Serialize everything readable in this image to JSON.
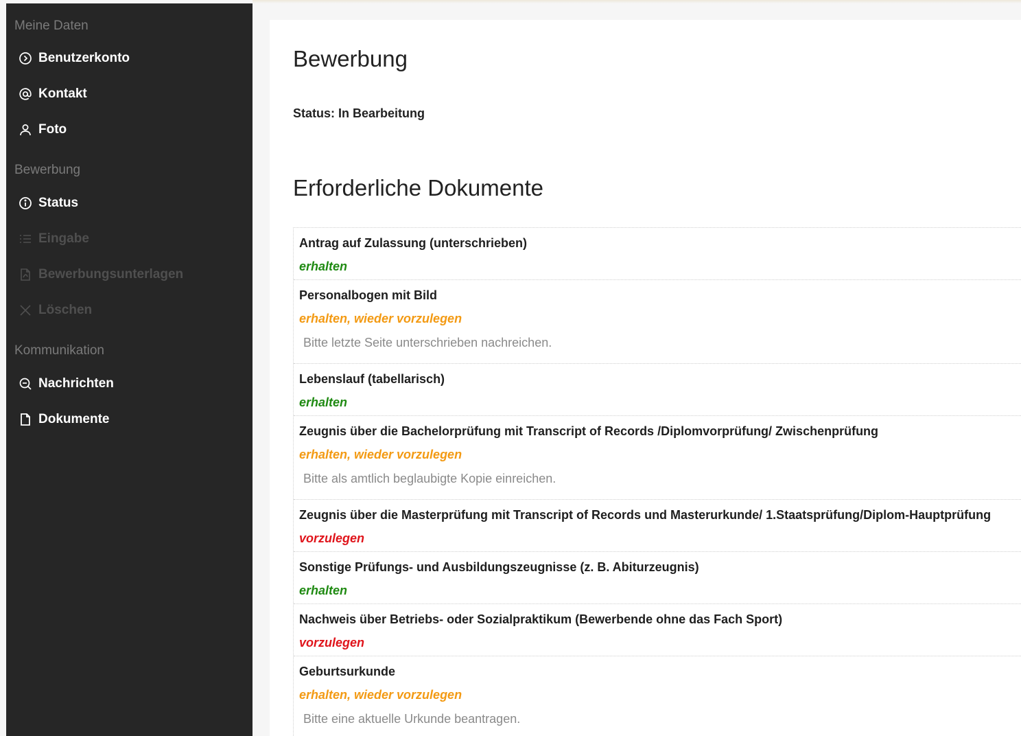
{
  "sidebar": {
    "sections": [
      {
        "label": "Meine Daten",
        "items": [
          {
            "label": "Benutzerkonto",
            "icon": "chevron-circle-icon",
            "disabled": false
          },
          {
            "label": "Kontakt",
            "icon": "at-icon",
            "disabled": false
          },
          {
            "label": "Foto",
            "icon": "user-icon",
            "disabled": false
          }
        ]
      },
      {
        "label": "Bewerbung",
        "items": [
          {
            "label": "Status",
            "icon": "info-circle-icon",
            "disabled": false,
            "active": true
          },
          {
            "label": "Eingabe",
            "icon": "list-icon",
            "disabled": true
          },
          {
            "label": "Bewerbungsunterlagen",
            "icon": "pdf-file-icon",
            "disabled": true
          },
          {
            "label": "Löschen",
            "icon": "close-icon",
            "disabled": true
          }
        ]
      },
      {
        "label": "Kommunikation",
        "items": [
          {
            "label": "Nachrichten",
            "icon": "chat-icon",
            "disabled": false
          },
          {
            "label": "Dokumente",
            "icon": "document-icon",
            "disabled": false
          }
        ]
      }
    ]
  },
  "main": {
    "title": "Bewerbung",
    "status": "Status: In Bearbeitung",
    "documents_title": "Erforderliche Dokumente",
    "status_colors": {
      "erhalten": "#1f8a12",
      "wieder": "#f39a13",
      "vorzulegen": "#e0141b"
    },
    "documents": [
      {
        "name": "Antrag auf Zulassung (unterschrieben)",
        "status": "erhalten",
        "status_type": "green",
        "note": ""
      },
      {
        "name": "Personalbogen mit Bild",
        "status": "erhalten, wieder vorzulegen",
        "status_type": "orange",
        "note": "Bitte letzte Seite unterschrieben nachreichen."
      },
      {
        "name": "Lebenslauf (tabellarisch)",
        "status": "erhalten",
        "status_type": "green",
        "note": ""
      },
      {
        "name": "Zeugnis über die Bachelorprüfung mit Transcript of Records /Diplomvorprüfung/ Zwischenprüfung",
        "status": "erhalten, wieder vorzulegen",
        "status_type": "orange",
        "note": "Bitte als amtlich beglaubigte Kopie einreichen."
      },
      {
        "name": "Zeugnis über die Masterprüfung mit Transcript of Records und Masterurkunde/ 1.Staatsprüfung/Diplom-Hauptprüfung",
        "status": "vorzulegen",
        "status_type": "red",
        "note": ""
      },
      {
        "name": "Sonstige Prüfungs- und Ausbildungszeugnisse (z. B. Abiturzeugnis)",
        "status": "erhalten",
        "status_type": "green",
        "note": ""
      },
      {
        "name": "Nachweis über Betriebs- oder Sozialpraktikum (Bewerbende ohne das Fach Sport)",
        "status": "vorzulegen",
        "status_type": "red",
        "note": ""
      },
      {
        "name": "Geburtsurkunde",
        "status": "erhalten, wieder vorzulegen",
        "status_type": "orange",
        "note": "Bitte eine aktuelle Urkunde beantragen."
      }
    ]
  }
}
